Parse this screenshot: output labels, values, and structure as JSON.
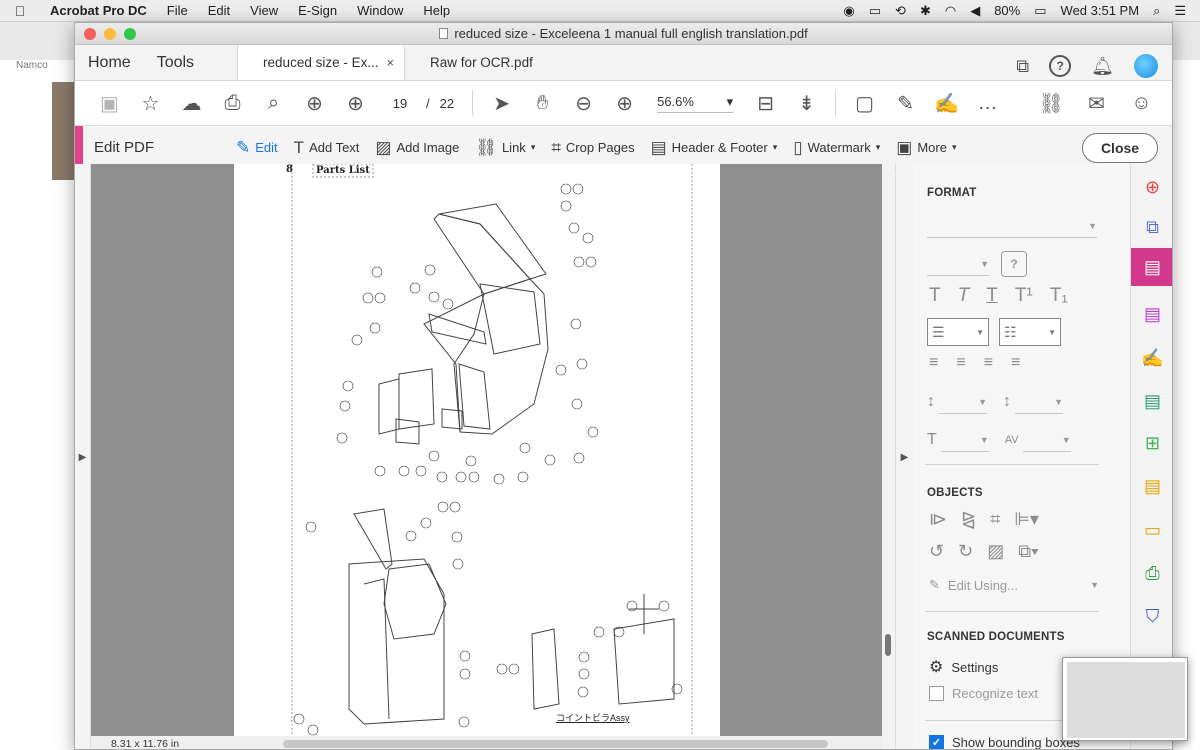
{
  "menubar": {
    "app_name": "Acrobat Pro DC",
    "items": [
      "File",
      "Edit",
      "View",
      "E-Sign",
      "Window",
      "Help"
    ],
    "battery": "80%",
    "clock": "Wed 3:51 PM"
  },
  "background": {
    "tab_label": "Namco"
  },
  "window": {
    "title": "reduced size - Exceleena 1 manual full english translation.pdf"
  },
  "tabs": {
    "home": "Home",
    "tools": "Tools",
    "active_doc": "reduced size - Ex...",
    "close_glyph": "×",
    "other_doc": "Raw for OCR.pdf"
  },
  "toolbar": {
    "current_page": "19",
    "page_separator": "/",
    "total_pages": "22",
    "zoom": "56.6%"
  },
  "editbar": {
    "title": "Edit PDF",
    "tools": [
      {
        "label": "Edit",
        "icon": "edit-text-icon"
      },
      {
        "label": "Add Text",
        "icon": "add-text-icon"
      },
      {
        "label": "Add Image",
        "icon": "add-image-icon"
      },
      {
        "label": "Link",
        "icon": "link-icon"
      },
      {
        "label": "Crop Pages",
        "icon": "crop-pages-icon"
      },
      {
        "label": "Header & Footer",
        "icon": "header-footer-icon"
      },
      {
        "label": "Watermark",
        "icon": "watermark-icon"
      },
      {
        "label": "More",
        "icon": "more-icon"
      }
    ],
    "close_label": "Close"
  },
  "document": {
    "section_number": "8",
    "heading": "Parts List",
    "caption": "コイントビラAssy",
    "page_size": "8.31 x 11.76 in"
  },
  "panel": {
    "format_heading": "FORMAT",
    "objects_heading": "OBJECTS",
    "edit_using": "Edit Using...",
    "scanned_heading": "SCANNED DOCUMENTS",
    "settings_label": "Settings",
    "recognize_label": "Recognize text",
    "bounding_label": "Show bounding boxes"
  },
  "colors": {
    "accent_blue": "#1473e6",
    "edit_pink": "#e2418b",
    "canvas_gray": "#8f8f8f"
  }
}
